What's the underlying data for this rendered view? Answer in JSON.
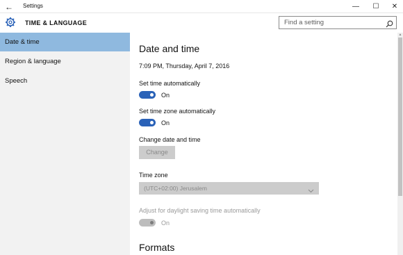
{
  "window": {
    "title": "Settings",
    "back_glyph": "←",
    "minimize_glyph": "—",
    "maximize_glyph": "☐",
    "close_glyph": "✕"
  },
  "header": {
    "icon": "gear-icon",
    "title": "TIME & LANGUAGE"
  },
  "search": {
    "placeholder": "Find a setting",
    "icon": "search-icon"
  },
  "sidebar": {
    "items": [
      {
        "label": "Date & time",
        "selected": true
      },
      {
        "label": "Region & language",
        "selected": false
      },
      {
        "label": "Speech",
        "selected": false
      }
    ]
  },
  "main": {
    "section_title": "Date and time",
    "current_datetime": "7:09 PM, Thursday, April 7, 2016",
    "set_time_auto": {
      "label": "Set time automatically",
      "state": "On"
    },
    "set_timezone_auto": {
      "label": "Set time zone automatically",
      "state": "On"
    },
    "change_datetime": {
      "label": "Change date and time",
      "button": "Change"
    },
    "time_zone": {
      "label": "Time zone",
      "value": "(UTC+02:00) Jerusalem"
    },
    "daylight": {
      "label": "Adjust for daylight saving time automatically",
      "state": "On"
    },
    "formats_title": "Formats"
  },
  "colors": {
    "accent": "#2a62b8",
    "nav_selected": "#8fb9df",
    "sidebar_bg": "#f2f2f2",
    "disabled_bg": "#cccccc"
  }
}
